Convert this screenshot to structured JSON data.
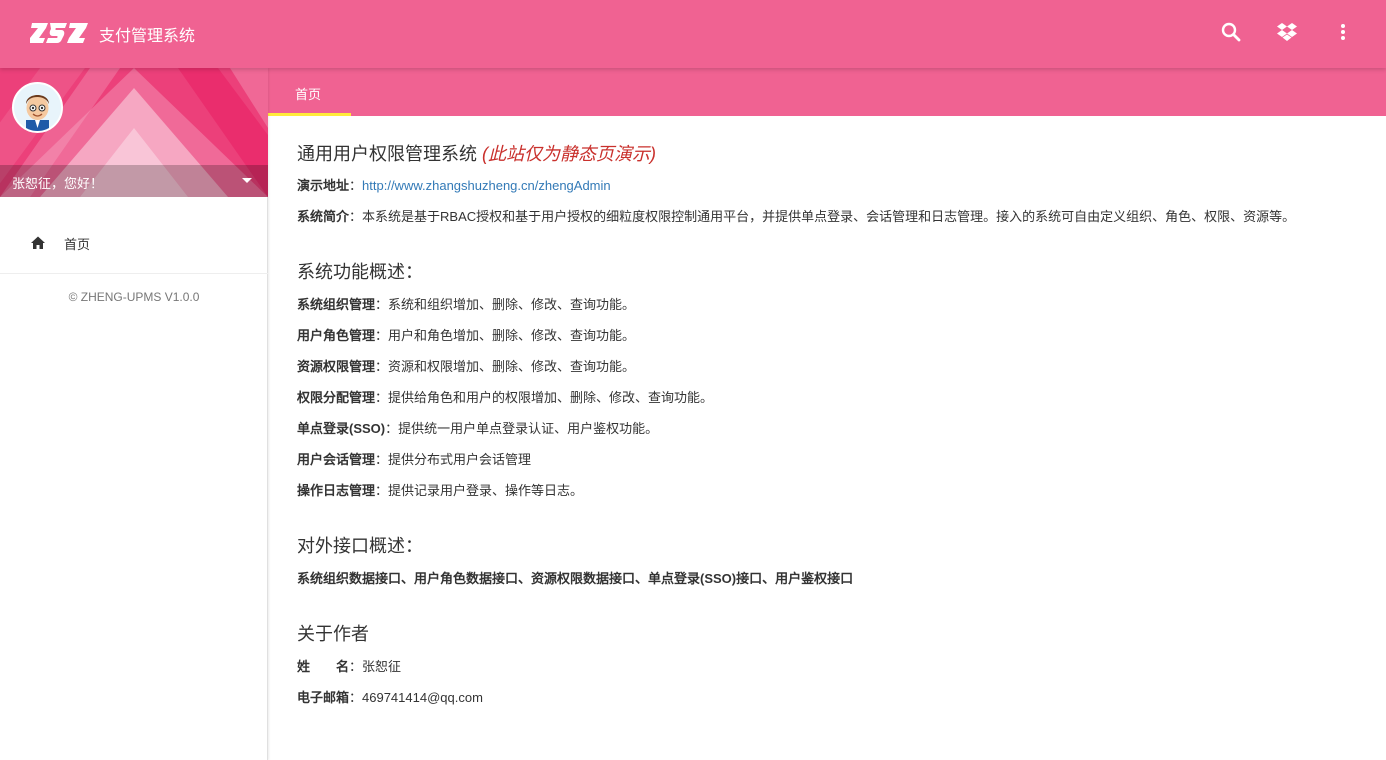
{
  "header": {
    "logo_text": "ZSZ",
    "title": "支付管理系统",
    "icons": [
      "search-icon",
      "dropbox-icon",
      "more-vert-icon"
    ],
    "color": "#f06292"
  },
  "sidebar": {
    "user_greeting": "张恕征，您好！",
    "nav_items": [
      {
        "label": "首页",
        "icon": "home-icon"
      }
    ],
    "copyright": "© ZHENG-UPMS V1.0.0"
  },
  "tabs": [
    {
      "label": "首页",
      "active": true
    }
  ],
  "content": {
    "title": "通用用户权限管理系统",
    "title_note": "(此站仅为静态页演示)",
    "demo_label": "演示地址",
    "demo_url": "http://www.zhangshuzheng.cn/zhengAdmin",
    "intro_label": "系统简介",
    "intro_text": "：本系统是基于RBAC授权和基于用户授权的细粒度权限控制通用平台，并提供单点登录、会话管理和日志管理。接入的系统可自由定义组织、角色、权限、资源等。",
    "features_title": "系统功能概述：",
    "features": [
      {
        "label": "系统组织管理",
        "text": "：系统和组织增加、删除、修改、查询功能。"
      },
      {
        "label": "用户角色管理",
        "text": "：用户和角色增加、删除、修改、查询功能。"
      },
      {
        "label": "资源权限管理",
        "text": "：资源和权限增加、删除、修改、查询功能。"
      },
      {
        "label": "权限分配管理",
        "text": "：提供给角色和用户的权限增加、删除、修改、查询功能。"
      },
      {
        "label": "单点登录(SSO)",
        "text": "：提供统一用户单点登录认证、用户鉴权功能。"
      },
      {
        "label": "用户会话管理",
        "text": "：提供分布式用户会话管理"
      },
      {
        "label": "操作日志管理",
        "text": "：提供记录用户登录、操作等日志。"
      }
    ],
    "api_title": "对外接口概述：",
    "api_text": "系统组织数据接口、用户角色数据接口、资源权限数据接口、单点登录(SSO)接口、用户鉴权接口",
    "about_title": "关于作者",
    "name_label": "姓　　名",
    "name_value": "：张恕征",
    "email_label": "电子邮箱",
    "email_value": "：469741414@qq.com"
  }
}
